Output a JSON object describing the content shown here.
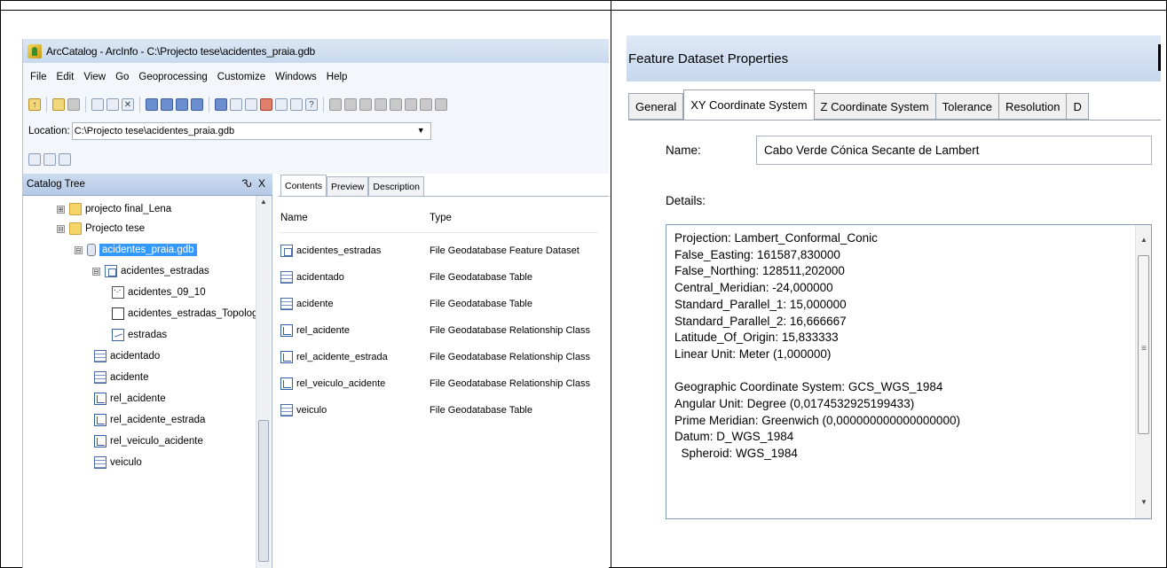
{
  "arccatalog": {
    "title": "ArcCatalog - ArcInfo - C:\\Projecto tese\\acidentes_praia.gdb",
    "menu": [
      "File",
      "Edit",
      "View",
      "Go",
      "Geoprocessing",
      "Customize",
      "Windows",
      "Help"
    ],
    "location_label": "Location:",
    "location_value": "C:\\Projecto tese\\acidentes_praia.gdb",
    "catalog_tree": {
      "header": "Catalog Tree",
      "header_controls": "Ԅ X",
      "nodes": [
        {
          "label": "projecto final_Lena",
          "icon": "folder-icon",
          "expander": "⊞"
        },
        {
          "label": "Projecto tese",
          "icon": "folder-icon",
          "expander": "⊟"
        },
        {
          "label": "acidentes_praia.gdb",
          "icon": "geodatabase-icon",
          "expander": "⊟",
          "selected": true
        },
        {
          "label": "acidentes_estradas",
          "icon": "feature-dataset-icon",
          "expander": "⊟"
        },
        {
          "label": "acidentes_09_10",
          "icon": "point-feature-class-icon"
        },
        {
          "label": "acidentes_estradas_Topology",
          "icon": "topology-icon"
        },
        {
          "label": "estradas",
          "icon": "line-feature-class-icon"
        },
        {
          "label": "acidentado",
          "icon": "table-icon"
        },
        {
          "label": "acidente",
          "icon": "table-icon"
        },
        {
          "label": "rel_acidente",
          "icon": "relationship-class-icon"
        },
        {
          "label": "rel_acidente_estrada",
          "icon": "relationship-class-icon"
        },
        {
          "label": "rel_veiculo_acidente",
          "icon": "relationship-class-icon"
        },
        {
          "label": "veiculo",
          "icon": "table-icon"
        }
      ]
    },
    "tabs": [
      "Contents",
      "Preview",
      "Description"
    ],
    "contents": {
      "columns": [
        "Name",
        "Type"
      ],
      "rows": [
        {
          "name": "acidentes_estradas",
          "type": "File Geodatabase Feature Dataset",
          "icon": "feature-dataset-icon"
        },
        {
          "name": "acidentado",
          "type": "File Geodatabase Table",
          "icon": "table-icon"
        },
        {
          "name": "acidente",
          "type": "File Geodatabase Table",
          "icon": "table-icon"
        },
        {
          "name": "rel_acidente",
          "type": "File Geodatabase Relationship Class",
          "icon": "relationship-class-icon"
        },
        {
          "name": "rel_acidente_estrada",
          "type": "File Geodatabase Relationship Class",
          "icon": "relationship-class-icon"
        },
        {
          "name": "rel_veiculo_acidente",
          "type": "File Geodatabase Relationship Class",
          "icon": "relationship-class-icon"
        },
        {
          "name": "veiculo",
          "type": "File Geodatabase Table",
          "icon": "table-icon"
        }
      ]
    }
  },
  "properties": {
    "title": "Feature Dataset Properties",
    "tabs": [
      "General",
      "XY Coordinate System",
      "Z Coordinate System",
      "Tolerance",
      "Resolution",
      "D"
    ],
    "active_tab": "XY Coordinate System",
    "name_label": "Name:",
    "name_value": "Cabo Verde Cónica Secante de Lambert",
    "details_label": "Details:",
    "details_lines": [
      "Projection: Lambert_Conformal_Conic",
      "False_Easting: 161587,830000",
      "False_Northing: 128511,202000",
      "Central_Meridian: -24,000000",
      "Standard_Parallel_1: 15,000000",
      "Standard_Parallel_2: 16,666667",
      "Latitude_Of_Origin: 15,833333",
      "Linear Unit: Meter (1,000000)",
      "",
      "Geographic Coordinate System: GCS_WGS_1984",
      "Angular Unit: Degree (0,0174532925199433)",
      "Prime Meridian: Greenwich (0,000000000000000000)",
      "Datum: D_WGS_1984",
      "  Spheroid: WGS_1984"
    ]
  }
}
